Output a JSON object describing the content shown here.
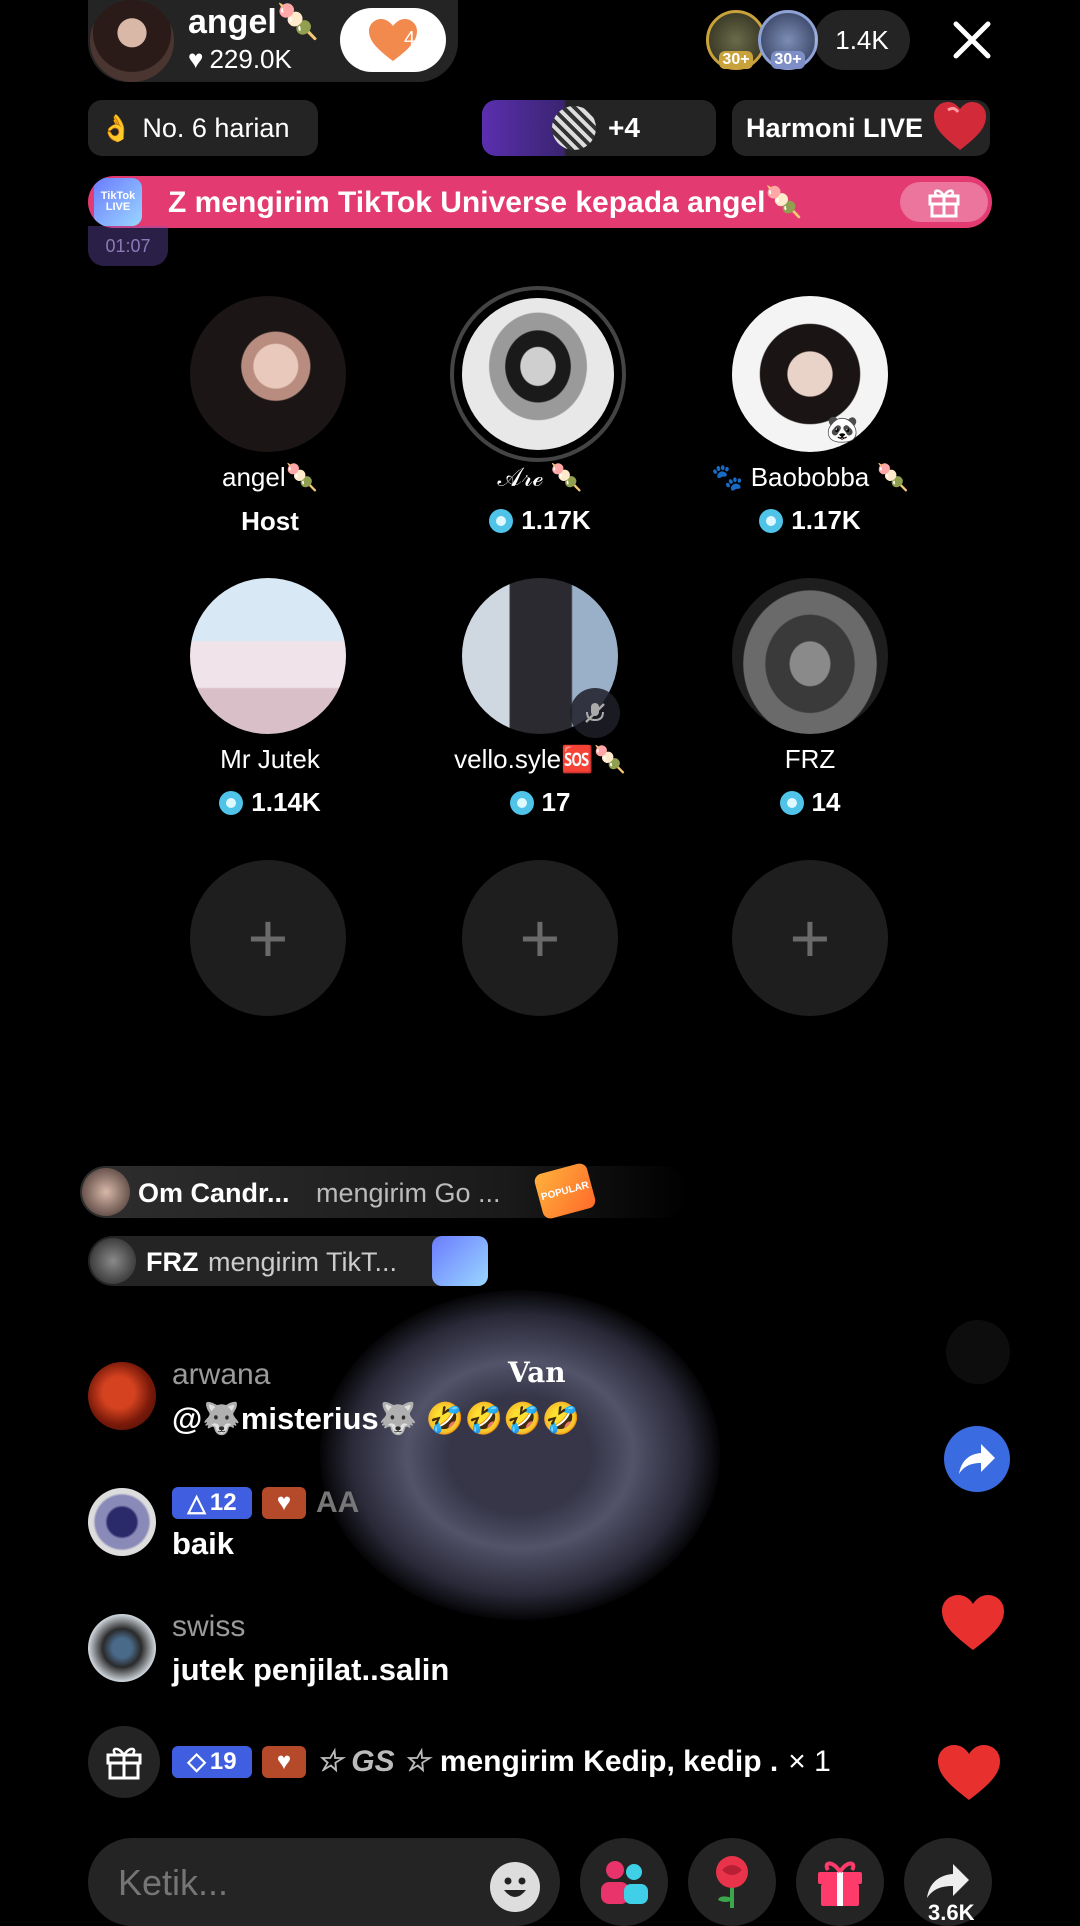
{
  "host": {
    "name": "angel🍡",
    "likes": "229.0K",
    "like_count": "4"
  },
  "top": {
    "viewer_count": "1.4K",
    "viewer_badge_1": "30+",
    "viewer_badge_2": "30+"
  },
  "rank": {
    "emoji": "👌",
    "label": "No. 6 harian"
  },
  "guests_pill": {
    "extra": "+4"
  },
  "harmoni": {
    "label": "Harmoni LIVE"
  },
  "banner": {
    "text": "Z mengirim TikTok Universe kepada angel🍡",
    "tiktok_live": "TikTok LIVE",
    "time": "01:07"
  },
  "seats": [
    {
      "name": "angel🍡",
      "sub": "Host"
    },
    {
      "name": "𝒜𝓇ℯ 🍡",
      "sub": "1.17K"
    },
    {
      "name": "🐾 Baobobba 🍡",
      "sub": "1.17K"
    },
    {
      "name": "Mr Jutek",
      "sub": "1.14K"
    },
    {
      "name": "vello.syle🆘🍡",
      "sub": "17"
    },
    {
      "name": "FRZ",
      "sub": "14"
    }
  ],
  "gift_notices": [
    {
      "user": "Om Candr...",
      "text": "mengirim Go ...",
      "tag": "POPULAR"
    },
    {
      "user": "FRZ",
      "text": "mengirim TikT..."
    }
  ],
  "overlay": {
    "name": "Van"
  },
  "chat": [
    {
      "user": "arwana",
      "msg": "@🐺misterius🐺 🤣🤣🤣🤣"
    },
    {
      "badge_level": "12",
      "badge_fan": "AA",
      "msg": "baik"
    },
    {
      "user": "swiss",
      "msg": "jutek penjilat..salin"
    }
  ],
  "gift_line": {
    "badge_level": "19",
    "user": "☆ GS ☆",
    "text": "mengirim Kedip, kedip .",
    "count": "× 1"
  },
  "input": {
    "placeholder": "Ketik..."
  },
  "share": {
    "count": "3.6K"
  },
  "colors": {
    "accent_pink": "#e8336b",
    "banner_bg": "#e23a71",
    "host_heart": "#f2894d"
  }
}
